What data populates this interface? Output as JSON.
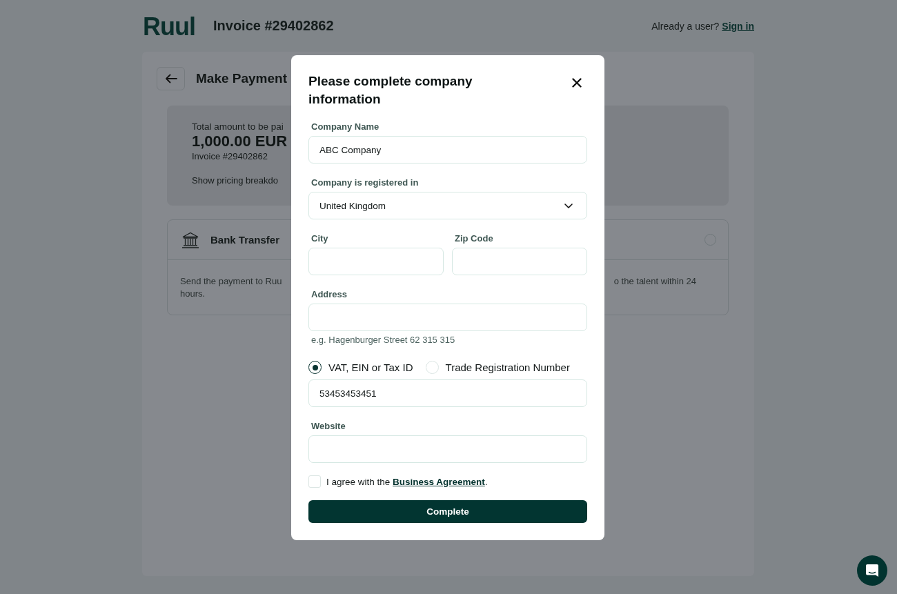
{
  "header": {
    "logo": "Ruul",
    "title": "Invoice #29402862",
    "signin_prompt": "Already a user?",
    "signin_link": "Sign in"
  },
  "page": {
    "title": "Make Payment",
    "summary": {
      "label": "Total amount to be pai",
      "amount": "1,000.00 EUR",
      "invoice": "Invoice #29402862",
      "breakdown_link": "Show pricing breakdo"
    },
    "payment_methods": [
      {
        "name": "Bank Transfer",
        "selected": false,
        "description_left": "Send the payment to Ruu",
        "description_right": "o the talent within 24",
        "description_end": "hours."
      }
    ]
  },
  "modal": {
    "title": "Please complete company information",
    "fields": [
      {
        "kind": "text",
        "label": "Company Name",
        "value": "ABC Company"
      },
      {
        "kind": "select",
        "label": "Company is registered in",
        "value": "United Kingdom"
      },
      {
        "kind": "row",
        "fields": [
          {
            "kind": "text",
            "label": "City"
          },
          {
            "kind": "text",
            "label": "Zip Code"
          }
        ]
      },
      {
        "kind": "text",
        "label": "Address",
        "hint": "e.g. Hagenburger Street 62 315 315"
      },
      {
        "kind": "choice",
        "options": [
          {
            "label": "VAT, EIN or Tax ID",
            "selected": true
          },
          {
            "label": "Trade Registration Number",
            "selected": false
          }
        ],
        "value": "53453453451"
      },
      {
        "kind": "text",
        "label": "Website"
      }
    ],
    "agreement": {
      "checked": false,
      "text_before": "I agree with the",
      "link": "Business Agreement",
      "text_after": "."
    },
    "submit": "Complete"
  }
}
